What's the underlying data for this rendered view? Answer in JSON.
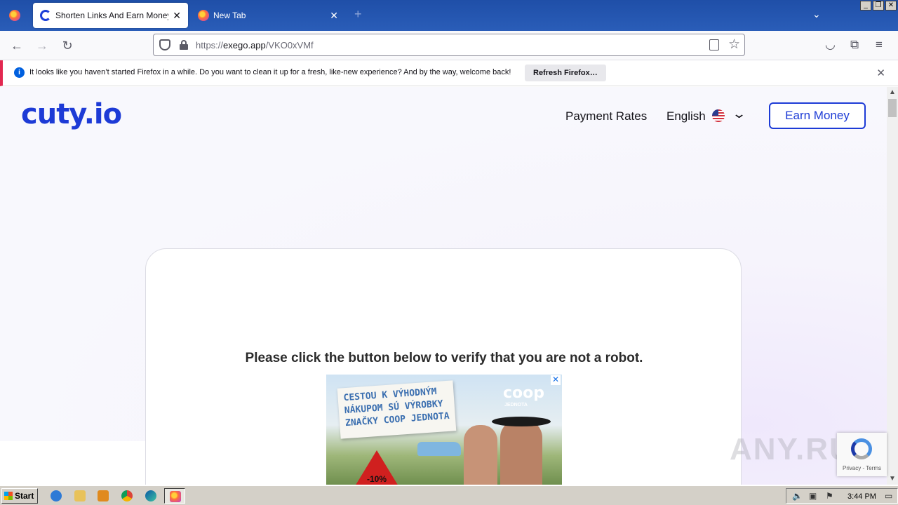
{
  "browser": {
    "tabs": [
      {
        "title": "Shorten Links And Earn Money | cu",
        "active": true
      },
      {
        "title": "New Tab",
        "active": false
      }
    ],
    "url": {
      "prefix": "https://",
      "host": "exego.app",
      "path": "/VKO0xVMf"
    },
    "notification": {
      "info_glyph": "i",
      "text": "It looks like you haven’t started Firefox in a while. Do you want to clean it up for a fresh, like-new experience? And by the way, welcome back!",
      "button": "Refresh Firefox…"
    }
  },
  "site": {
    "logo": "cuty.io",
    "nav": {
      "payment_rates": "Payment Rates",
      "language": "English",
      "cta": "Earn Money"
    },
    "verify_text": "Please click the button below to verify that you are not a robot.",
    "ad": {
      "headline": "CESTOU K VÝHODNÝM NÁKUPOM SÚ VÝROBKY ZNAČKY COOP JEDNOTA",
      "brand": "coop",
      "brand_sub": "JEDNOTA",
      "sign_label": "-10%",
      "close": "✕"
    },
    "recaptcha": "Privacy - Terms",
    "watermark": "ANY.RUN"
  },
  "taskbar": {
    "start": "Start",
    "clock": "3:44 PM"
  },
  "colors": {
    "brand": "#1d3bd6",
    "tabbar": "#2a5db8",
    "notification_accent": "#e22850"
  }
}
